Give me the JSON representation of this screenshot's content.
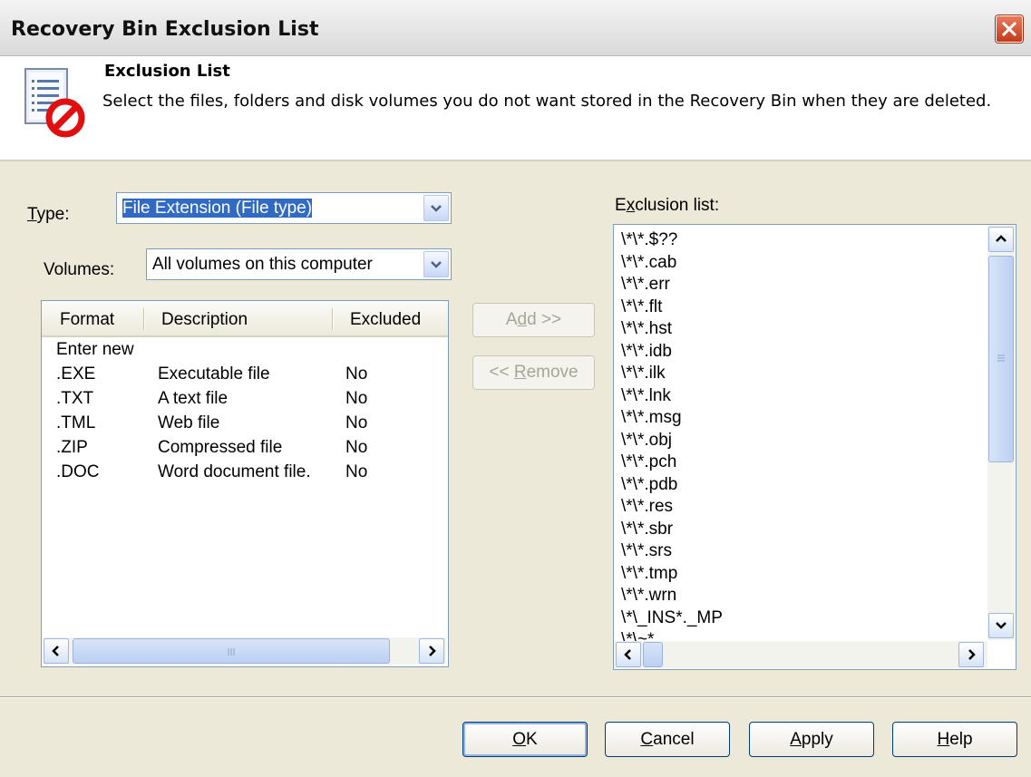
{
  "window": {
    "title": "Recovery Bin Exclusion List"
  },
  "header": {
    "title": "Exclusion List",
    "description": "Select the files, folders and disk volumes you do not want stored in the Recovery Bin when they are deleted."
  },
  "type": {
    "label_accel": "T",
    "label_rest": "ype:",
    "value": "File Extension (File type)"
  },
  "volumes": {
    "label": "Volumes:",
    "value": "All volumes on this computer"
  },
  "listview": {
    "columns": [
      "Format",
      "Description",
      "Excluded"
    ],
    "enter_new": "Enter new",
    "rows": [
      {
        "format": ".EXE",
        "description": "Executable file",
        "excluded": "No"
      },
      {
        "format": ".TXT",
        "description": "A text file",
        "excluded": "No"
      },
      {
        "format": ".TML",
        "description": "Web file",
        "excluded": "No"
      },
      {
        "format": ".ZIP",
        "description": "Compressed file",
        "excluded": "No"
      },
      {
        "format": ".DOC",
        "description": "Word document file.",
        "excluded": "No"
      }
    ]
  },
  "buttons": {
    "add_pre": "A",
    "add_accel": "d",
    "add_post": "d >>",
    "remove_pre": "<< ",
    "remove_accel": "R",
    "remove_post": "emove",
    "ok_accel": "O",
    "ok_rest": "K",
    "cancel_accel": "C",
    "cancel_rest": "ancel",
    "apply_pre": "",
    "apply_accel": "A",
    "apply_rest": "pply",
    "help_accel": "H",
    "help_rest": "elp"
  },
  "exclusion": {
    "label_pre": "E",
    "label_accel": "x",
    "label_post": "clusion list:",
    "items": [
      "\\*\\*.$??",
      "\\*\\*.cab",
      "\\*\\*.err",
      "\\*\\*.flt",
      "\\*\\*.hst",
      "\\*\\*.idb",
      "\\*\\*.ilk",
      "\\*\\*.lnk",
      "\\*\\*.msg",
      "\\*\\*.obj",
      "\\*\\*.pch",
      "\\*\\*.pdb",
      "\\*\\*.res",
      "\\*\\*.sbr",
      "\\*\\*.srs",
      "\\*\\*.tmp",
      "\\*\\*.wrn",
      "\\*\\_INS*._MP",
      "\\*\\~*"
    ]
  },
  "icons": {
    "header": "exclusion-list-icon",
    "close": "close-icon"
  },
  "colors": {
    "dialog_bg": "#ece9d8",
    "selection": "#316ac5",
    "close_red": "#c43a1a",
    "field_border": "#7f9db9"
  }
}
